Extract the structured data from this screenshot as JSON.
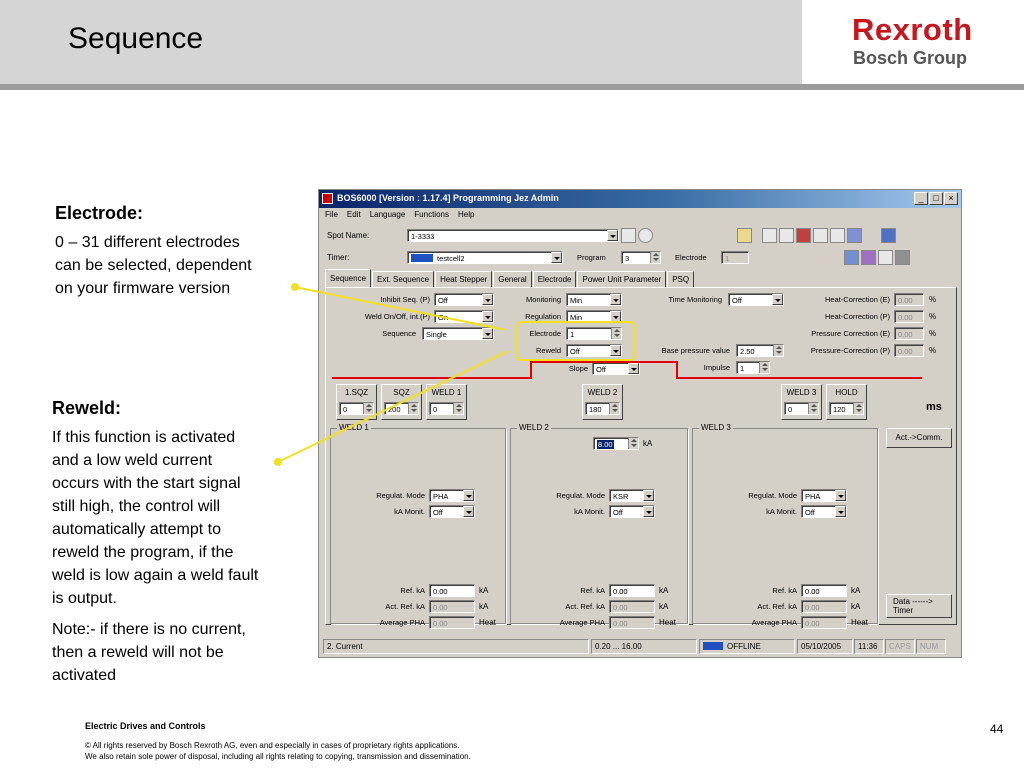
{
  "slide": {
    "title": "Sequence",
    "logo_line1": "Rexroth",
    "logo_line2": "Bosch Group",
    "electrode_heading": "Electrode:",
    "electrode_lines": [
      "0 – 31  different electrodes",
      "can be selected, dependent",
      "on your firmware version"
    ],
    "reweld_heading": "Reweld:",
    "reweld_lines": [
      "If this function is activated",
      "and a low weld current",
      "occurs with the start signal",
      "still high, the control will",
      "automatically attempt to",
      "reweld the program, if the",
      "weld is low again a weld fault",
      "is output."
    ],
    "note_lines": [
      "Note:- if there is no current,",
      "then a reweld will not be",
      "activated"
    ],
    "footer_company": "Electric Drives and Controls",
    "footer_line1": "© All rights reserved by Bosch Rexroth AG, even and especially in cases of proprietary rights applications.",
    "footer_line2": "We also retain sole power of disposal, including all rights relating to copying, transmission and dissemination.",
    "page_number": "44"
  },
  "app": {
    "title": "BOS6000 [Version : 1.17.4] Programming Jez Admin",
    "window_buttons": [
      "_",
      "□",
      "×"
    ],
    "menu": [
      "File",
      "Edit",
      "Language",
      "Functions",
      "Help"
    ],
    "spot_name_label": "Spot Name:",
    "spot_name_value": "1-3333",
    "timer_label": "Timer:",
    "timer_value": "testcell2",
    "program_label": "Program",
    "program_value": "3",
    "electrode_top_label": "Electrode",
    "electrode_top_value": "1",
    "tabs": [
      "Sequence",
      "Ext. Sequence",
      "Heat Stepper",
      "General",
      "Electrode",
      "Power Unit Parameter",
      "PSQ"
    ],
    "inhibit_label": "Inhibit Seq. (P)",
    "inhibit_value": "Off",
    "weld_onoff_label": "Weld On/Off, int.(P)",
    "weld_onoff_value": "On",
    "sequence_label": "Sequence",
    "sequence_value": "Single",
    "monitoring_label": "Monitoring",
    "monitoring_value": "Min",
    "regulation_label": "Regulation",
    "regulation_value": "Min",
    "electrode_label": "Electrode",
    "electrode_value": "1",
    "reweld_label": "Reweld",
    "reweld_value": "Off",
    "slope_label": "Slope",
    "slope_value": "Off",
    "time_monitoring_label": "Time Monitoring",
    "time_monitoring_value": "Off",
    "base_pressure_label": "Base pressure value",
    "base_pressure_value": "2.50",
    "impulse_label": "Impulse",
    "impulse_value": "1",
    "corrections": [
      {
        "label": "Heat-Correction (E)",
        "value": "0.00",
        "unit": "%"
      },
      {
        "label": "Heat-Correction (P)",
        "value": "0.00",
        "unit": "%"
      },
      {
        "label": "Pressure Correction (E)",
        "value": "0.00",
        "unit": "%"
      },
      {
        "label": "Pressure-Correction (P)",
        "value": "0.00",
        "unit": "%"
      }
    ],
    "phases": [
      {
        "label": "1.SQZ",
        "value": "0"
      },
      {
        "label": "SQZ",
        "value": "200"
      },
      {
        "label": "WELD 1",
        "value": "0"
      },
      {
        "label": "WELD 2",
        "value": "180"
      },
      {
        "label": "WELD 3",
        "value": "0"
      },
      {
        "label": "HOLD",
        "value": "120"
      }
    ],
    "ms_label": "ms",
    "weld2_current": "8.00",
    "ka_unit": "kA",
    "act_comm_button": "Act.->Comm.",
    "data_timer_button_l1": "Data   ------>",
    "data_timer_button_l2": "Timer",
    "weld_groups": [
      {
        "title": "WELD 1",
        "mode": "PHA",
        "monit": "Off",
        "ref": "0.00",
        "act": "0.00",
        "avg": "0.00"
      },
      {
        "title": "WELD 2",
        "mode": "KSR",
        "monit": "Off",
        "ref": "0.00",
        "act": "0.00",
        "avg": "0.00"
      },
      {
        "title": "WELD 3",
        "mode": "PHA",
        "monit": "Off",
        "ref": "0.00",
        "act": "0.00",
        "avg": "0.00"
      }
    ],
    "regulat_mode_label": "Regulat. Mode",
    "ka_monit_label": "kA Monit.",
    "ref_ka_label": "Ref. kA",
    "act_ref_ka_label": "Act. Ref. kA",
    "avg_pha_label": "Average PHA",
    "heat_label": "Heat",
    "status_left": "2. Current",
    "status_range": "0.20 ... 16.00",
    "status_mode": "OFFLINE",
    "status_date": "05/10/2005",
    "status_time": "11:36",
    "status_caps": "CAPS",
    "status_num": "NUM"
  }
}
